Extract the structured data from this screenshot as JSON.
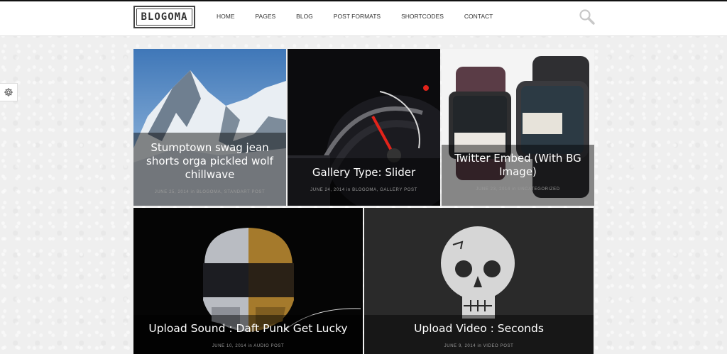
{
  "header": {
    "logo_text": "BLOGOMA",
    "nav": [
      {
        "label": "HOME"
      },
      {
        "label": "PAGES"
      },
      {
        "label": "BLOG"
      },
      {
        "label": "POST FORMATS"
      },
      {
        "label": "SHORTCODES"
      },
      {
        "label": "CONTACT"
      }
    ],
    "search_icon": "search-icon"
  },
  "settings_icon": "gear-icon",
  "posts": [
    {
      "title": "Stumptown swag jean shorts orga pickled wolf chillwave",
      "date": "JUNE 25, 2014",
      "in": "IN",
      "categories": "BLOGOMA, STANDART POST"
    },
    {
      "title": "Gallery Type: Slider",
      "date": "JUNE 24, 2014",
      "in": "IN",
      "categories": "BLOGOMA, GALLERY POST"
    },
    {
      "title": "Twitter Embed (With BG Image)",
      "date": "JUNE 23, 2014",
      "in": "IN",
      "categories": "UNCATEGORIZED"
    },
    {
      "title": "Upload Sound : Daft Punk Get Lucky",
      "date": "JUNE 10, 2014",
      "in": "IN",
      "categories": "AUDIO POST"
    },
    {
      "title": "Upload Video : Seconds",
      "date": "JUNE 9, 2014",
      "in": "IN",
      "categories": "VIDEO POST"
    }
  ],
  "colors": {
    "accent": "#111111",
    "caption_bg": "rgba(0,0,0,0.45)",
    "meta": "#9a9a9a"
  }
}
